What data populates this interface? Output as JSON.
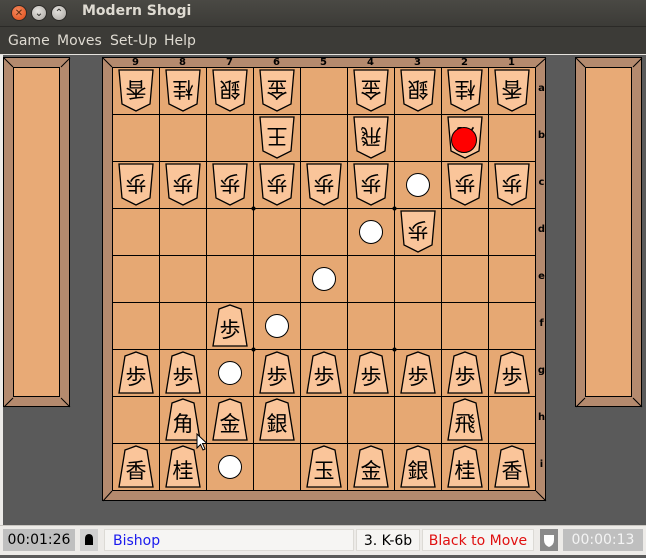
{
  "window": {
    "title": "Modern Shogi",
    "controls": [
      "close",
      "minimize",
      "maximize"
    ]
  },
  "menu": [
    "Game",
    "Moves",
    "Set-Up",
    "Help"
  ],
  "board": {
    "files": [
      "9",
      "8",
      "7",
      "6",
      "5",
      "4",
      "3",
      "2",
      "1"
    ],
    "ranks": [
      "a",
      "b",
      "c",
      "d",
      "e",
      "f",
      "g",
      "h",
      "i"
    ],
    "pieces": [
      {
        "square": "9a",
        "kanji": "香",
        "name": "lance",
        "side": "white"
      },
      {
        "square": "8a",
        "kanji": "桂",
        "name": "knight",
        "side": "white"
      },
      {
        "square": "7a",
        "kanji": "銀",
        "name": "silver",
        "side": "white"
      },
      {
        "square": "6a",
        "kanji": "金",
        "name": "gold",
        "side": "white"
      },
      {
        "square": "4a",
        "kanji": "金",
        "name": "gold",
        "side": "white"
      },
      {
        "square": "3a",
        "kanji": "銀",
        "name": "silver",
        "side": "white"
      },
      {
        "square": "2a",
        "kanji": "桂",
        "name": "knight",
        "side": "white"
      },
      {
        "square": "1a",
        "kanji": "香",
        "name": "lance",
        "side": "white"
      },
      {
        "square": "6b",
        "kanji": "王",
        "name": "king",
        "side": "white"
      },
      {
        "square": "4b",
        "kanji": "飛",
        "name": "rook",
        "side": "white"
      },
      {
        "square": "2b",
        "kanji": "角",
        "name": "bishop",
        "side": "white"
      },
      {
        "square": "9c",
        "kanji": "歩",
        "name": "pawn",
        "side": "white"
      },
      {
        "square": "8c",
        "kanji": "歩",
        "name": "pawn",
        "side": "white"
      },
      {
        "square": "7c",
        "kanji": "歩",
        "name": "pawn",
        "side": "white"
      },
      {
        "square": "6c",
        "kanji": "歩",
        "name": "pawn",
        "side": "white"
      },
      {
        "square": "5c",
        "kanji": "歩",
        "name": "pawn",
        "side": "white"
      },
      {
        "square": "4c",
        "kanji": "歩",
        "name": "pawn",
        "side": "white"
      },
      {
        "square": "2c",
        "kanji": "歩",
        "name": "pawn",
        "side": "white"
      },
      {
        "square": "1c",
        "kanji": "歩",
        "name": "pawn",
        "side": "white"
      },
      {
        "square": "3d",
        "kanji": "歩",
        "name": "pawn",
        "side": "white"
      },
      {
        "square": "7f",
        "kanji": "歩",
        "name": "pawn",
        "side": "black"
      },
      {
        "square": "9g",
        "kanji": "歩",
        "name": "pawn",
        "side": "black"
      },
      {
        "square": "8g",
        "kanji": "歩",
        "name": "pawn",
        "side": "black"
      },
      {
        "square": "6g",
        "kanji": "歩",
        "name": "pawn",
        "side": "black"
      },
      {
        "square": "5g",
        "kanji": "歩",
        "name": "pawn",
        "side": "black"
      },
      {
        "square": "4g",
        "kanji": "歩",
        "name": "pawn",
        "side": "black"
      },
      {
        "square": "3g",
        "kanji": "歩",
        "name": "pawn",
        "side": "black"
      },
      {
        "square": "2g",
        "kanji": "歩",
        "name": "pawn",
        "side": "black"
      },
      {
        "square": "1g",
        "kanji": "歩",
        "name": "pawn",
        "side": "black"
      },
      {
        "square": "8h",
        "kanji": "角",
        "name": "bishop",
        "side": "black"
      },
      {
        "square": "7h",
        "kanji": "金",
        "name": "gold",
        "side": "black"
      },
      {
        "square": "6h",
        "kanji": "銀",
        "name": "silver",
        "side": "black"
      },
      {
        "square": "2h",
        "kanji": "飛",
        "name": "rook",
        "side": "black"
      },
      {
        "square": "9i",
        "kanji": "香",
        "name": "lance",
        "side": "black"
      },
      {
        "square": "8i",
        "kanji": "桂",
        "name": "knight",
        "side": "black"
      },
      {
        "square": "5i",
        "kanji": "玉",
        "name": "king",
        "side": "black"
      },
      {
        "square": "4i",
        "kanji": "金",
        "name": "gold",
        "side": "black"
      },
      {
        "square": "3i",
        "kanji": "銀",
        "name": "silver",
        "side": "black"
      },
      {
        "square": "2i",
        "kanji": "桂",
        "name": "knight",
        "side": "black"
      },
      {
        "square": "1i",
        "kanji": "香",
        "name": "lance",
        "side": "black"
      }
    ],
    "move_hints": [
      "3c",
      "4d",
      "5e",
      "6f",
      "7g",
      "7i"
    ],
    "selected_marker": "2b"
  },
  "status": {
    "black_clock": "00:01:26",
    "black_icon": "bell-icon",
    "piece_name": "Bishop",
    "last_move": "3. K-6b",
    "turn": "Black to Move",
    "white_icon": "shield-icon",
    "white_clock": "00:00:13"
  },
  "colors": {
    "board": "#e6a873",
    "frame": "#b48a6e",
    "piece": "#fac59a",
    "hint": "#ffffff",
    "selected": "#ff0000",
    "piece_name_text": "#1a1aee",
    "turn_text": "#e01010"
  }
}
